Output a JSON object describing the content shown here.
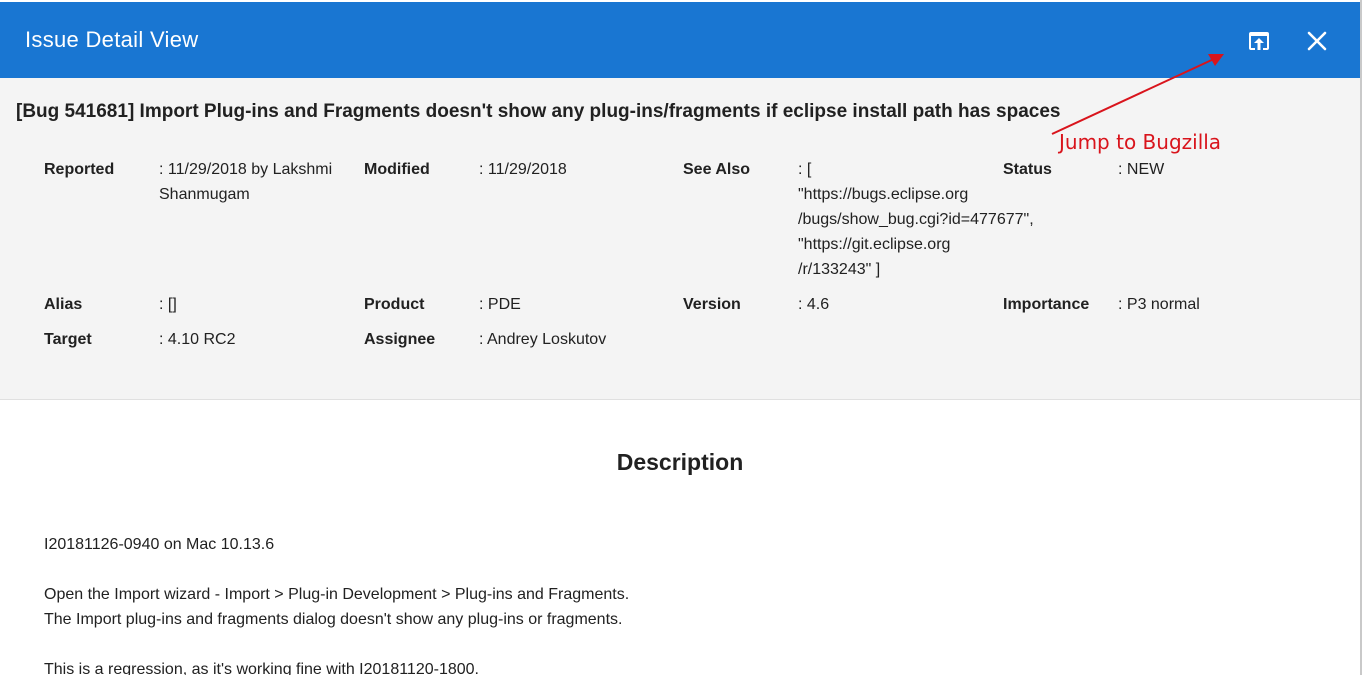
{
  "dialog": {
    "title": "Issue Detail View",
    "open_icon": "open-in-browser-icon",
    "close_icon": "close-icon"
  },
  "issue": {
    "title": "[Bug 541681] Import Plug-ins and Fragments doesn't show any plug-ins/fragments if eclipse install path has spaces",
    "reported": {
      "label": "Reported",
      "value_lines": [
        ": 11/29/2018 by Lakshmi",
        "Shanmugam"
      ]
    },
    "modified": {
      "label": "Modified",
      "value": ": 11/29/2018"
    },
    "see_also": {
      "label": "See Also",
      "value_lines": [
        ": [",
        "\"https://bugs.eclipse.org",
        "/bugs/show_bug.cgi?id=477677\",",
        "\"https://git.eclipse.org",
        "/r/133243\" ]"
      ]
    },
    "status": {
      "label": "Status",
      "value": ": NEW"
    },
    "alias": {
      "label": "Alias",
      "value": ": []"
    },
    "product": {
      "label": "Product",
      "value": ": PDE"
    },
    "version": {
      "label": "Version",
      "value": ": 4.6"
    },
    "importance": {
      "label": "Importance",
      "value": ": P3 normal"
    },
    "target": {
      "label": "Target",
      "value": ": 4.10 RC2"
    },
    "assignee": {
      "label": "Assignee",
      "value": ": Andrey Loskutov"
    }
  },
  "annotation": {
    "text": "Jump to Bugzilla",
    "color": "#d9141c"
  },
  "description": {
    "heading": "Description",
    "lines": [
      "I20181126-0940 on Mac 10.13.6",
      "Open the Import wizard - Import > Plug-in Development > Plug-ins and Fragments.",
      "The Import plug-ins and fragments dialog doesn't show any plug-ins or fragments.",
      "This is a regression, as it's working fine with I20181120-1800."
    ]
  },
  "colors": {
    "header_bg": "#1976d2",
    "summary_bg": "#f4f4f4"
  }
}
